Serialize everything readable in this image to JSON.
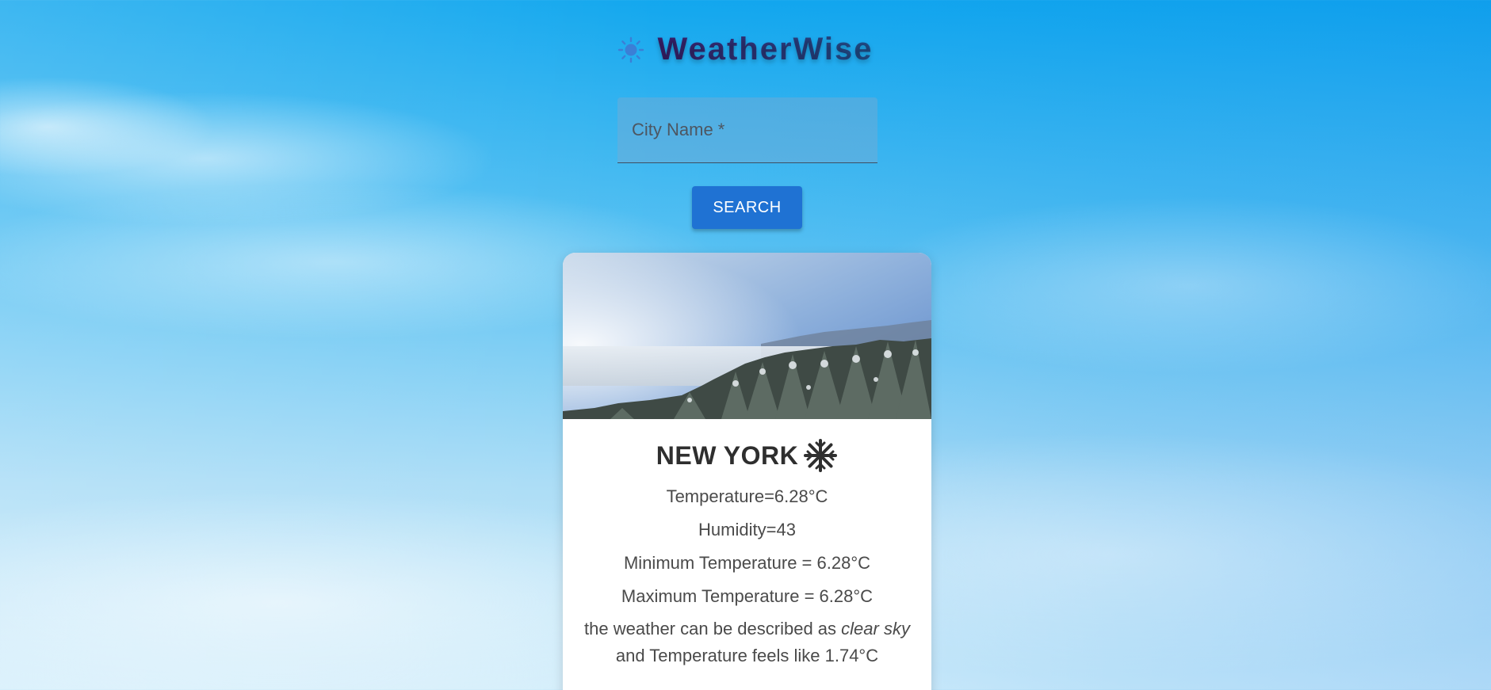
{
  "app": {
    "title": "WeatherWise",
    "logo_icon": "sun-icon"
  },
  "search": {
    "placeholder": "City Name *",
    "value": "",
    "button_label": "SEARCH"
  },
  "weather_card": {
    "image": "snowy-forest-landscape",
    "city": "NEW YORK",
    "condition_icon": "snowflake-icon",
    "temperature": "Temperature=6.28°C",
    "humidity": "Humidity=43",
    "min_temperature": "Minimum Temperature = 6.28°C",
    "max_temperature": "Maximum Temperature = 6.28°C",
    "description_prefix": "the weather can be described as ",
    "description_condition": "clear sky",
    "description_suffix": " and Temperature feels like 1.74°C"
  },
  "colors": {
    "accent": "#1f72d3",
    "title": "#2b2a63",
    "sun": "#3b7fd6"
  }
}
